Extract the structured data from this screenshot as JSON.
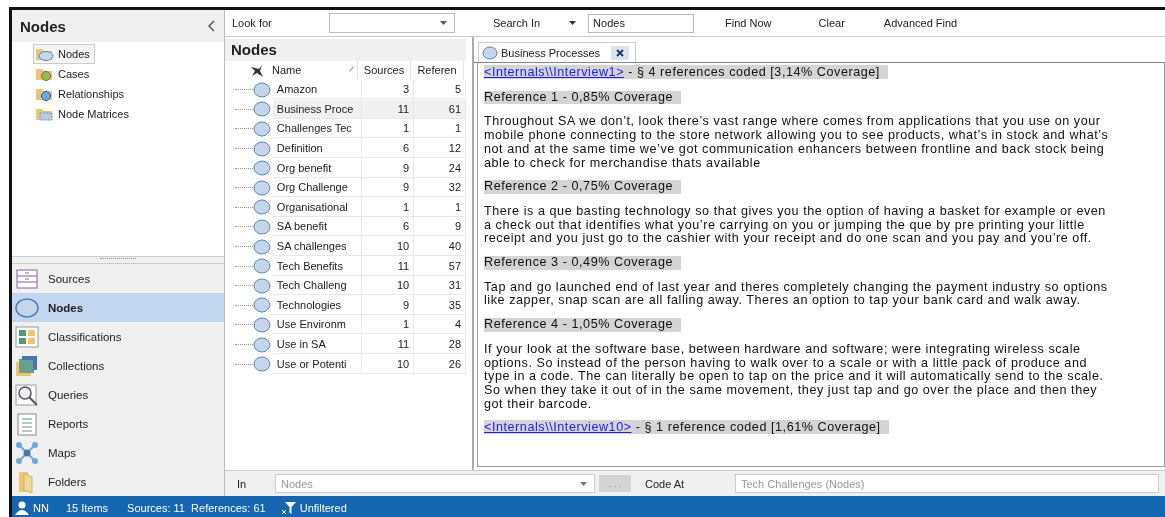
{
  "navigation": {
    "title": "Nodes",
    "tree": [
      {
        "label": "Nodes",
        "selected": true,
        "kind": "nodes"
      },
      {
        "label": "Cases",
        "selected": false,
        "kind": "cases"
      },
      {
        "label": "Relationships",
        "selected": false,
        "kind": "relationships"
      },
      {
        "label": "Node Matrices",
        "selected": false,
        "kind": "matrices"
      }
    ],
    "sections": [
      {
        "label": "Sources",
        "selected": false,
        "kind": "sources"
      },
      {
        "label": "Nodes",
        "selected": true,
        "kind": "nodes"
      },
      {
        "label": "Classifications",
        "selected": false,
        "kind": "classifications"
      },
      {
        "label": "Collections",
        "selected": false,
        "kind": "collections"
      },
      {
        "label": "Queries",
        "selected": false,
        "kind": "queries"
      },
      {
        "label": "Reports",
        "selected": false,
        "kind": "reports"
      },
      {
        "label": "Maps",
        "selected": false,
        "kind": "maps"
      },
      {
        "label": "Folders",
        "selected": false,
        "kind": "folders"
      }
    ]
  },
  "find_bar": {
    "look_for_label": "Look for",
    "search_in_label": "Search In",
    "search_in_value": "Nodes",
    "buttons": [
      "Find Now",
      "Clear",
      "Advanced Find"
    ]
  },
  "node_list": {
    "title": "Nodes",
    "columns": [
      "Name",
      "Sources",
      "Referen"
    ],
    "rows": [
      {
        "name": "Amazon",
        "sources": "3",
        "references": "5",
        "selected": false
      },
      {
        "name": "Business Proce",
        "sources": "11",
        "references": "61",
        "selected": true
      },
      {
        "name": "Challenges Tec",
        "sources": "1",
        "references": "1",
        "selected": false
      },
      {
        "name": "Definition",
        "sources": "6",
        "references": "12",
        "selected": false
      },
      {
        "name": "Org benefit",
        "sources": "9",
        "references": "24",
        "selected": false
      },
      {
        "name": "Org Challenge",
        "sources": "9",
        "references": "32",
        "selected": false
      },
      {
        "name": "Organisational",
        "sources": "1",
        "references": "1",
        "selected": false
      },
      {
        "name": "SA benefit",
        "sources": "6",
        "references": "9",
        "selected": false
      },
      {
        "name": "SA challenges",
        "sources": "10",
        "references": "40",
        "selected": false
      },
      {
        "name": "Tech Benefits",
        "sources": "11",
        "references": "57",
        "selected": false
      },
      {
        "name": "Tech Challeng",
        "sources": "10",
        "references": "31",
        "selected": false
      },
      {
        "name": "Technologies",
        "sources": "9",
        "references": "35",
        "selected": false
      },
      {
        "name": "Use Environm",
        "sources": "1",
        "references": "4",
        "selected": false
      },
      {
        "name": "Use in SA",
        "sources": "11",
        "references": "28",
        "selected": false
      },
      {
        "name": "Use or Potenti",
        "sources": "10",
        "references": "26",
        "selected": false
      }
    ]
  },
  "detail": {
    "tab": {
      "label": "Business Processes"
    },
    "blocks": [
      {
        "kind": "source",
        "link": "<Internals\\\\Interview1>",
        "text": "- § 4 references coded  [3,14% Coverage]"
      },
      {
        "kind": "reference",
        "text": "Reference 1 - 0,85% Coverage"
      },
      {
        "kind": "paragraph",
        "text": "Throughout SA we don’t, look there’s vast range where comes from applications that you use on your mobile phone connecting to the store network allowing you to see products, what’s in stock and what’s not and at the same time we’ve got communication enhancers between frontline and back stock being able to check for merchandise thats available"
      },
      {
        "kind": "reference",
        "text": "Reference 2 - 0,75% Coverage"
      },
      {
        "kind": "paragraph",
        "text": "There is a que basting technology so that gives you the option of having a basket for example or even a check out that identifies what you’re carrying on you or jumping the que by pre printing your little receipt and you just go to the cashier with your receipt and do one scan and you pay and you’re off."
      },
      {
        "kind": "reference",
        "text": "Reference 3 - 0,49% Coverage"
      },
      {
        "kind": "paragraph",
        "text": "Tap and go launched end of last year and theres completely changing the payment industry so options like zapper, snap scan are all falling away. Theres an option to tap your bank card and walk away."
      },
      {
        "kind": "reference",
        "text": "Reference 4 - 1,05% Coverage"
      },
      {
        "kind": "paragraph",
        "text": "If your look at the software base, between hardware and software; were integrating wireless scale options. So instead of the person having to walk over to a scale or with a little pack of produce and type in a code. The can literally be open to tap on the price and it will automatically send to the scale. So when they take it out of in the same movement, they just tap and go over the place and then they got their barcode."
      },
      {
        "kind": "source",
        "link": "<Internals\\\\Interview10>",
        "text": "- § 1 reference coded  [1,61% Coverage]"
      }
    ]
  },
  "code_bar": {
    "in_label": "In",
    "in_value": "Nodes",
    "in_disabled": true,
    "browse_button": ". . .",
    "code_at_label": "Code At",
    "code_at_value": "Tech Challenges (Nodes)",
    "code_at_disabled": true
  },
  "status_bar": {
    "user": "NN",
    "items": "15 Items",
    "counts": "Sources: 11  References: 61",
    "filter": "Unfiltered"
  }
}
